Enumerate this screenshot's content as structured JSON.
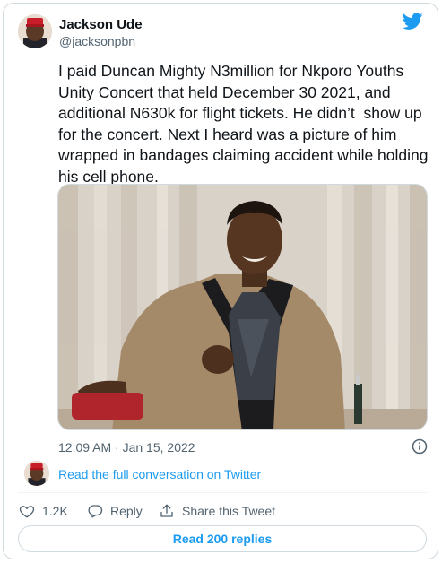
{
  "author": {
    "name": "Jackson Ude",
    "handle": "@jacksonpbn",
    "avatar_icon": "user-avatar"
  },
  "tweet": {
    "text": "I paid Duncan Mighty N3million for Nkporo Youths Unity Concert that held December 30 2021, and additional N630k for flight tickets. He didn’t  show up for the concert. Next I heard was a picture of him wrapped in bandages claiming accident while holding his cell phone.",
    "timestamp": "12:09 AM · Jan 15, 2022"
  },
  "conversation_link": "Read the full conversation on Twitter",
  "actions": {
    "likes": "1.2K",
    "reply_label": "Reply",
    "share_label": "Share this Tweet"
  },
  "read_replies_label": "Read 200 replies",
  "colors": {
    "accent": "#1d9bf0",
    "text": "#0f1419",
    "secondary": "#536471",
    "border": "#cfd9de"
  },
  "icons": {
    "brand": "twitter-bird-icon",
    "info": "info-icon",
    "like": "heart-icon",
    "reply": "speech-bubble-icon",
    "share": "share-icon"
  }
}
